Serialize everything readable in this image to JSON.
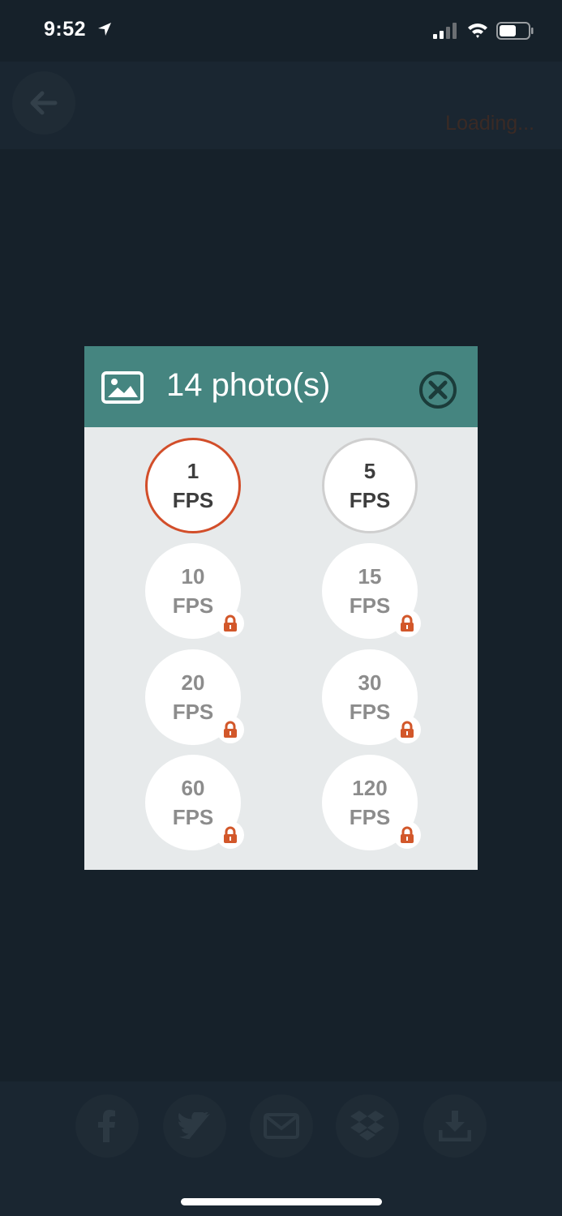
{
  "status_bar": {
    "time": "9:52"
  },
  "header": {
    "loading_text": "Loading..."
  },
  "modal": {
    "title": "14 photo(s)",
    "options": [
      {
        "value": "1",
        "unit": "FPS",
        "state": "selected",
        "locked": false
      },
      {
        "value": "5",
        "unit": "FPS",
        "state": "available",
        "locked": false
      },
      {
        "value": "10",
        "unit": "FPS",
        "state": "locked",
        "locked": true
      },
      {
        "value": "15",
        "unit": "FPS",
        "state": "locked",
        "locked": true
      },
      {
        "value": "20",
        "unit": "FPS",
        "state": "locked",
        "locked": true
      },
      {
        "value": "30",
        "unit": "FPS",
        "state": "locked",
        "locked": true
      },
      {
        "value": "60",
        "unit": "FPS",
        "state": "locked",
        "locked": true
      },
      {
        "value": "120",
        "unit": "FPS",
        "state": "locked",
        "locked": true
      }
    ]
  },
  "share_bar": {
    "icons": [
      "facebook-icon",
      "twitter-icon",
      "mail-icon",
      "dropbox-icon",
      "download-icon"
    ]
  },
  "colors": {
    "accent": "#d24e2a",
    "modal_header": "#458580",
    "lock": "#d2572a"
  }
}
